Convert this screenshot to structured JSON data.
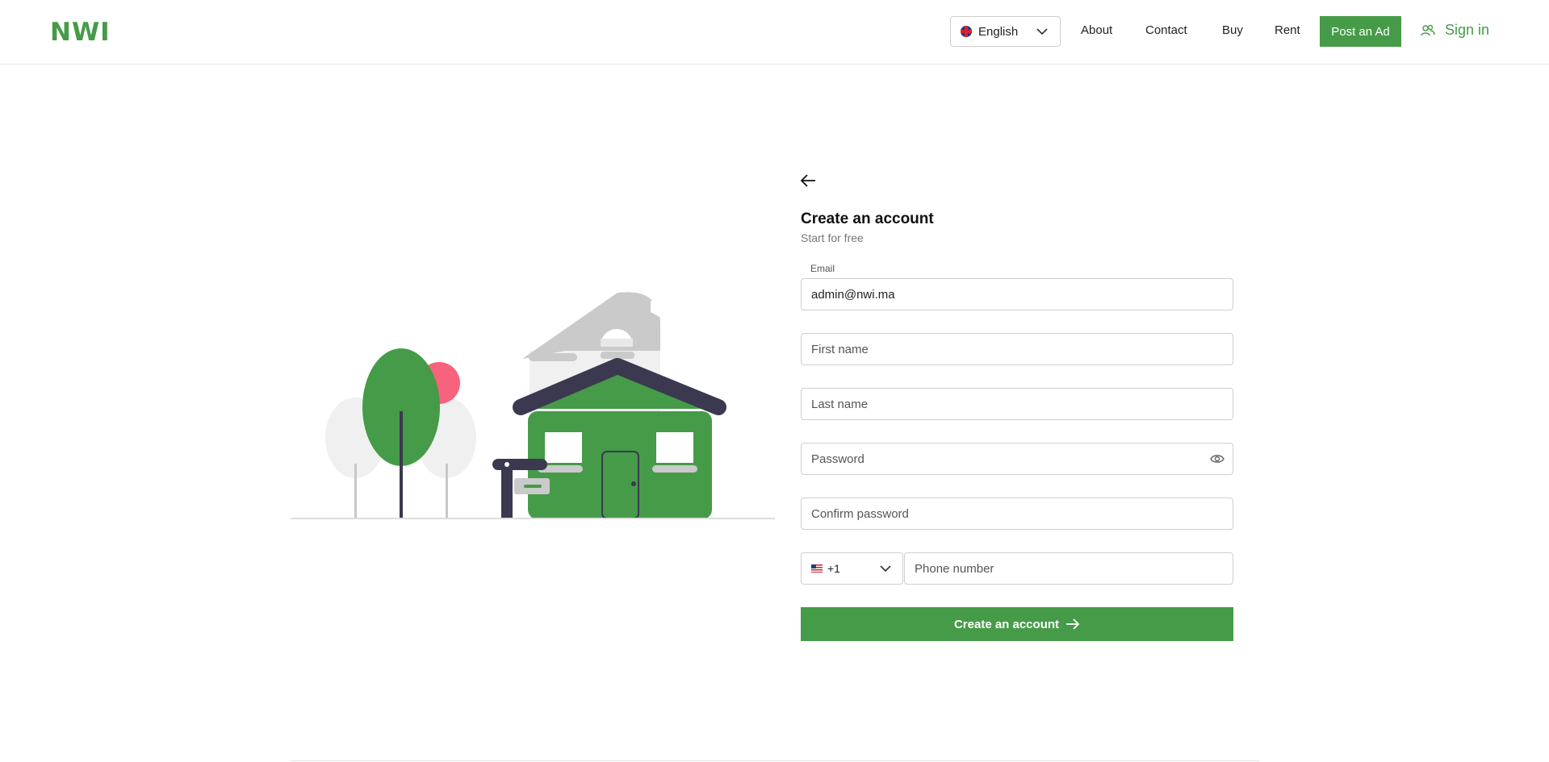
{
  "brand": {
    "logo_text": "NWI",
    "color": "#469b48"
  },
  "header": {
    "language": {
      "selected": "English",
      "flag_icon": "uk-flag-icon"
    },
    "nav": {
      "about": "About",
      "contact": "Contact",
      "buy": "Buy",
      "rent": "Rent"
    },
    "post_ad_label": "Post an Ad",
    "sign_in_label": "Sign in"
  },
  "form": {
    "title": "Create an account",
    "subtitle": "Start for free",
    "email_label": "Email",
    "email_value": "admin@nwi.ma",
    "first_name_placeholder": "First name",
    "last_name_placeholder": "Last name",
    "password_placeholder": "Password",
    "confirm_password_placeholder": "Confirm password",
    "country_code": "+1",
    "country_flag_icon": "us-flag-icon",
    "phone_placeholder": "Phone number",
    "submit_label": "Create an account"
  }
}
